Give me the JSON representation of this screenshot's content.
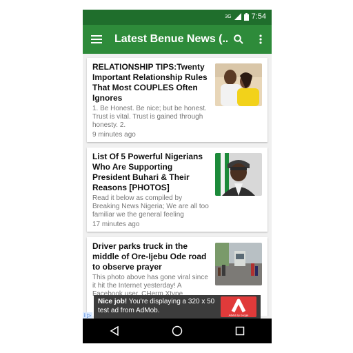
{
  "status_bar": {
    "network": "3G",
    "time": "7:54"
  },
  "app_bar": {
    "title": "Latest Benue News (..."
  },
  "articles": [
    {
      "headline": "RELATIONSHIP TIPS:Twenty Important Relationship Rules That Most COUPLES Often Ignores",
      "excerpt": "1. Be Honest. Be nice; but be honest. Trust is vital. Trust is gained through honesty. 2.",
      "time": "9 minutes ago"
    },
    {
      "headline": "List Of 5 Powerful Nigerians Who Are Supporting President Buhari & Their Reasons [PHOTOS]",
      "excerpt": "Read it below as compiled by Breaking News Nigeria; We are all too familiar we the general feeling",
      "time": "17 minutes ago"
    },
    {
      "headline": "Driver parks truck in the middle of Ore-Ijebu Ode road to observe prayer",
      "excerpt": "This photo above has gone viral since it hit the Internet yesterday! A Facebook user, CHerm Xtype",
      "time": ""
    }
  ],
  "ad": {
    "bold": "Nice job!",
    "text": " You're displaying a 320 x 50 test ad from AdMob.",
    "badge": "AdMob by Google"
  },
  "colors": {
    "status_bar": "#1f6e2c",
    "app_bar": "#2e8b3a"
  }
}
